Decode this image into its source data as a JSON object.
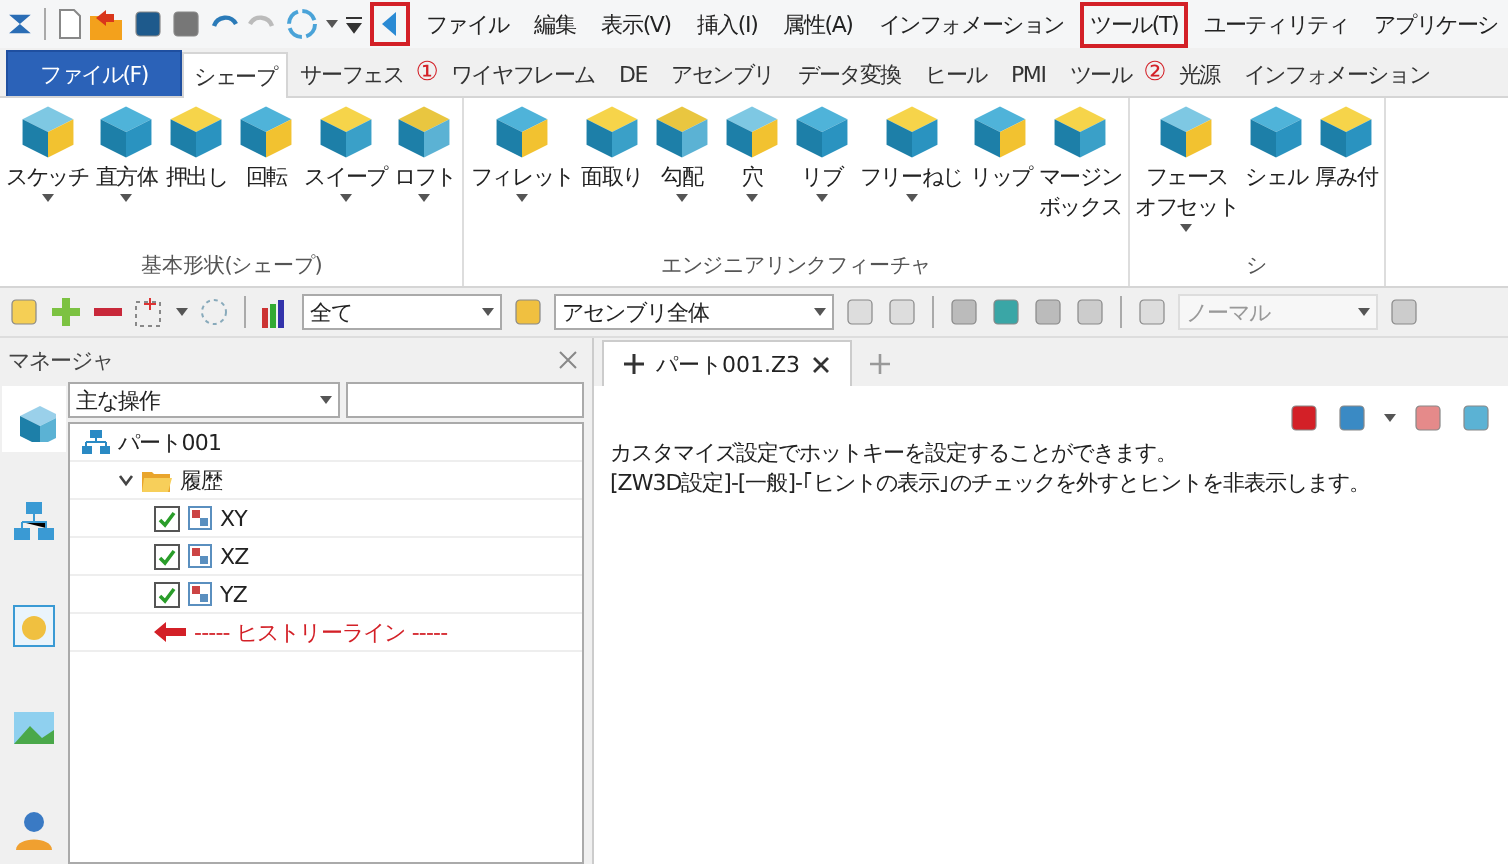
{
  "quick_toolbar": {
    "back_annotated": true
  },
  "menu": [
    {
      "label": "ファイル",
      "annotated": false
    },
    {
      "label": "編集",
      "annotated": false
    },
    {
      "label": "表示(V)",
      "annotated": false
    },
    {
      "label": "挿入(I)",
      "annotated": false
    },
    {
      "label": "属性(A)",
      "annotated": false
    },
    {
      "label": "インフォメーション",
      "annotated": false
    },
    {
      "label": "ツール(T)",
      "annotated": true
    },
    {
      "label": "ユーティリティ",
      "annotated": false
    },
    {
      "label": "アプリケーシ",
      "annotated": false
    }
  ],
  "tabs": [
    {
      "label": "ファイル(F)",
      "kind": "file",
      "selected": false
    },
    {
      "label": "シェープ",
      "kind": "tab",
      "selected": true
    },
    {
      "label": "サーフェス",
      "kind": "tab",
      "selected": false,
      "marker": "①"
    },
    {
      "label": "ワイヤフレーム",
      "kind": "tab",
      "selected": false
    },
    {
      "label": "DE",
      "kind": "tab",
      "selected": false
    },
    {
      "label": "アセンブリ",
      "kind": "tab",
      "selected": false
    },
    {
      "label": "データ変換",
      "kind": "tab",
      "selected": false
    },
    {
      "label": "ヒール",
      "kind": "tab",
      "selected": false
    },
    {
      "label": "PMI",
      "kind": "tab",
      "selected": false
    },
    {
      "label": "ツール",
      "kind": "tab",
      "selected": false,
      "marker": "②"
    },
    {
      "label": "光源",
      "kind": "tab",
      "selected": false
    },
    {
      "label": "インフォメーション",
      "kind": "tab",
      "selected": false
    }
  ],
  "ribbon": [
    {
      "label": "基本形状(シェープ)",
      "buttons": [
        {
          "lines": [
            "スケッチ"
          ],
          "dropdown": true
        },
        {
          "lines": [
            "直方体"
          ],
          "dropdown": true
        },
        {
          "lines": [
            "押出し"
          ],
          "dropdown": false
        },
        {
          "lines": [
            "回転"
          ],
          "dropdown": false
        },
        {
          "lines": [
            "スイープ"
          ],
          "dropdown": true
        },
        {
          "lines": [
            "ロフト"
          ],
          "dropdown": true
        }
      ]
    },
    {
      "label": "エンジニアリンクフィーチャ",
      "buttons": [
        {
          "lines": [
            "フィレット"
          ],
          "dropdown": true
        },
        {
          "lines": [
            "面取り"
          ],
          "dropdown": false
        },
        {
          "lines": [
            "勾配"
          ],
          "dropdown": true
        },
        {
          "lines": [
            "穴"
          ],
          "dropdown": true
        },
        {
          "lines": [
            "リブ"
          ],
          "dropdown": true
        },
        {
          "lines": [
            "フリーねじ"
          ],
          "dropdown": true
        },
        {
          "lines": [
            "リップ"
          ],
          "dropdown": false
        },
        {
          "lines": [
            "マージン",
            "ボックス"
          ],
          "dropdown": false
        }
      ]
    },
    {
      "label": "シ",
      "buttons": [
        {
          "lines": [
            "フェース",
            "オフセット"
          ],
          "dropdown": true
        },
        {
          "lines": [
            "シェル"
          ],
          "dropdown": false
        },
        {
          "lines": [
            "厚み付"
          ],
          "dropdown": false
        }
      ]
    }
  ],
  "toolbar": {
    "filter": "全て",
    "scope": "アセンブリ全体",
    "mode": {
      "value": "ノーマル",
      "disabled": true
    }
  },
  "manager": {
    "title": "マネージャ",
    "operation": "主な操作",
    "side_tabs": [
      {
        "selected": true
      },
      {
        "selected": false
      },
      {
        "selected": false
      },
      {
        "selected": false
      },
      {
        "selected": false
      }
    ],
    "tree": [
      {
        "label": "パート001",
        "kind": "part",
        "children": [
          {
            "label": "履歴",
            "kind": "folder",
            "expanded": true,
            "children": [
              {
                "label": "XY",
                "kind": "plane",
                "checked": true
              },
              {
                "label": "XZ",
                "kind": "plane",
                "checked": true
              },
              {
                "label": "YZ",
                "kind": "plane",
                "checked": true
              },
              {
                "label": "----- ヒストリーライン -----",
                "kind": "history"
              }
            ]
          }
        ]
      }
    ]
  },
  "document": {
    "tab": "パート001.Z3",
    "hint": [
      "カスタマイズ設定でホットキーを設定することができます。",
      "[ZW3D設定]-[一般]-｢ヒントの表示｣のチェックを外すとヒントを非表示します。"
    ]
  }
}
